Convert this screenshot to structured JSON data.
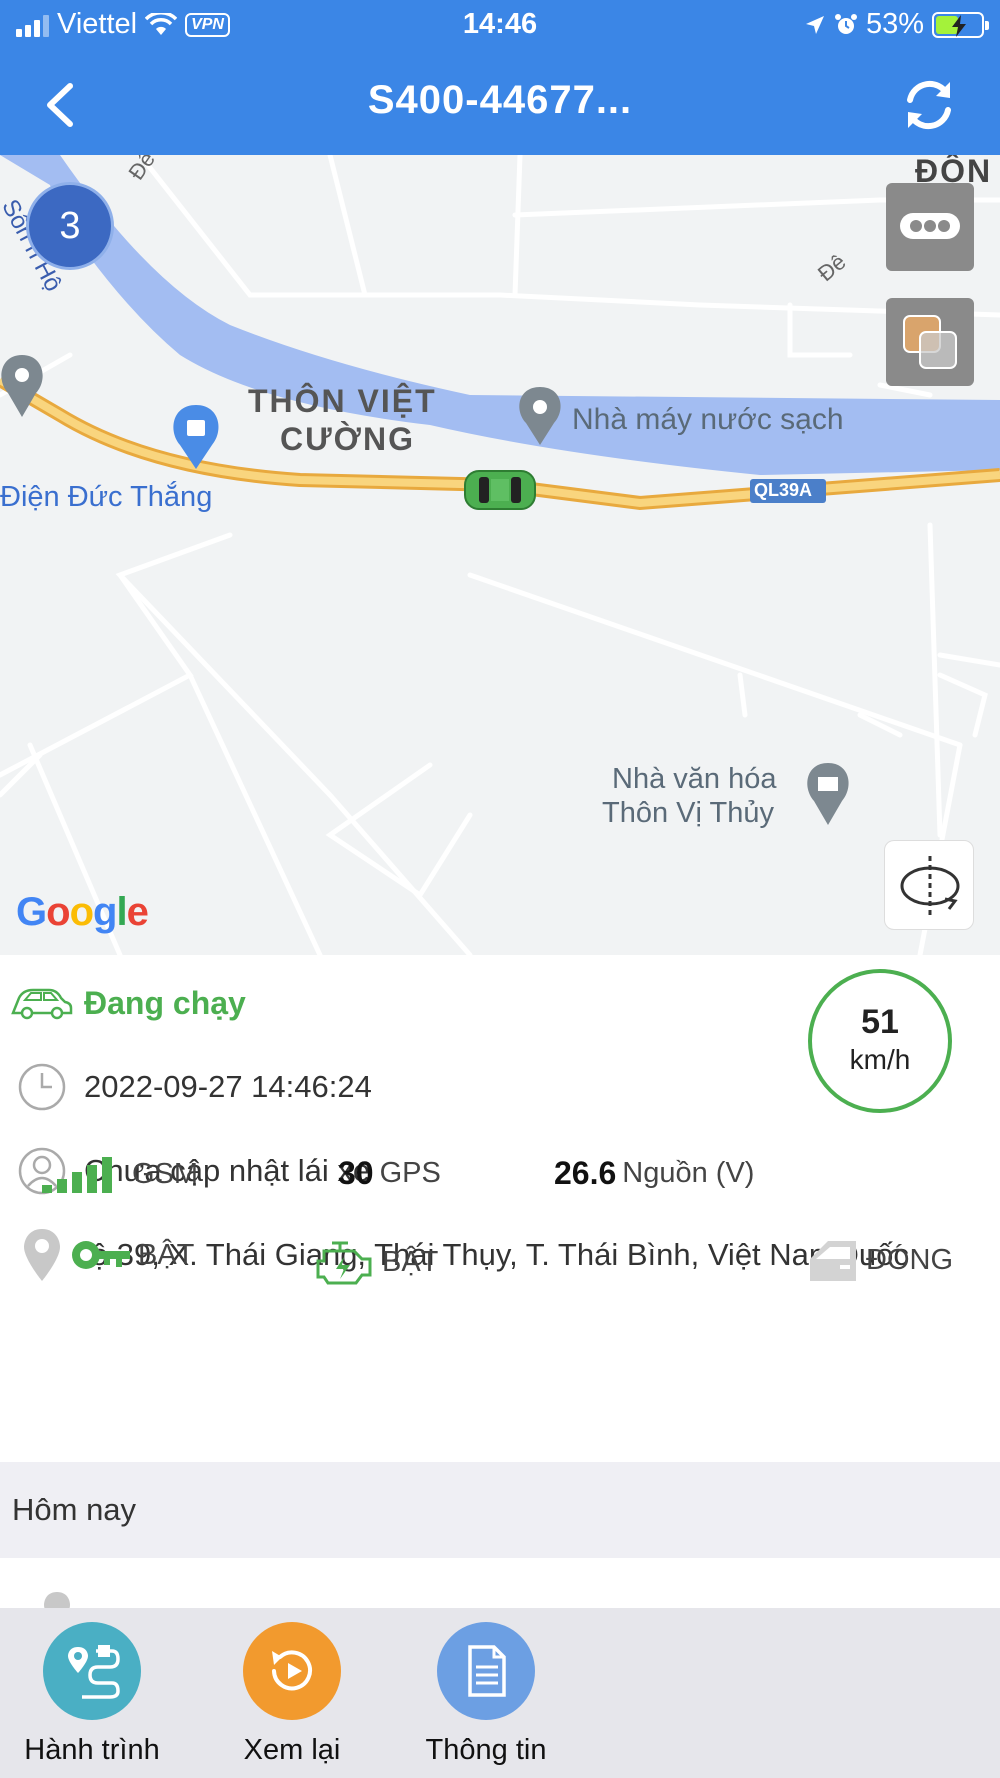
{
  "status_bar": {
    "carrier": "Viettel",
    "vpn": "VPN",
    "time": "14:46",
    "battery_percent": "53%",
    "battery_level": 0.53
  },
  "header": {
    "title": "S400-44677...",
    "back_icon": "chevron-left-icon",
    "refresh_icon": "refresh-icon",
    "background": "#3b86e6"
  },
  "map": {
    "cluster_count": "3",
    "labels": {
      "dong": "ĐÔN",
      "de_1": "Đê",
      "de_2": "Đê",
      "river": "Sôn h Hộ",
      "village": "THÔN VIỆT",
      "village_2": "CƯỜNG",
      "factory": "Nhà máy nước sạch",
      "shop": "Điện Đức Thắng",
      "highway": "QL39A",
      "culture_1": "Nhà văn hóa",
      "culture_2": "Thôn Vị Thủy"
    },
    "google_logo": "Google"
  },
  "vehicle": {
    "status": "Đang chạy",
    "timestamp": "2022-09-27 14:46:24",
    "driver": "Chưa cập nhật lái xe",
    "address": "lộ 39, X. Thái Giang, Thái Thụy, T. Thái Bình, Việt NamQuốc",
    "speed_value": "51",
    "speed_unit": "km/h",
    "status_color": "#4caf50"
  },
  "metrics": {
    "gsm_label": "GSM",
    "gps_value": "30",
    "gps_label": "GPS",
    "power_value": "26.6",
    "power_label": "Nguồn (V)"
  },
  "states": {
    "key_label": "BẬT",
    "engine_label": "BẬT",
    "door_label": "ĐÓNG"
  },
  "today": {
    "label": "Hôm nay"
  },
  "tabs": [
    {
      "label": "Hành trình",
      "color": "#4aafc4",
      "icon": "route-icon"
    },
    {
      "label": "Xem lại",
      "color": "#f29a2e",
      "icon": "replay-icon"
    },
    {
      "label": "Thông tin",
      "color": "#6c9fe3",
      "icon": "document-icon"
    }
  ]
}
